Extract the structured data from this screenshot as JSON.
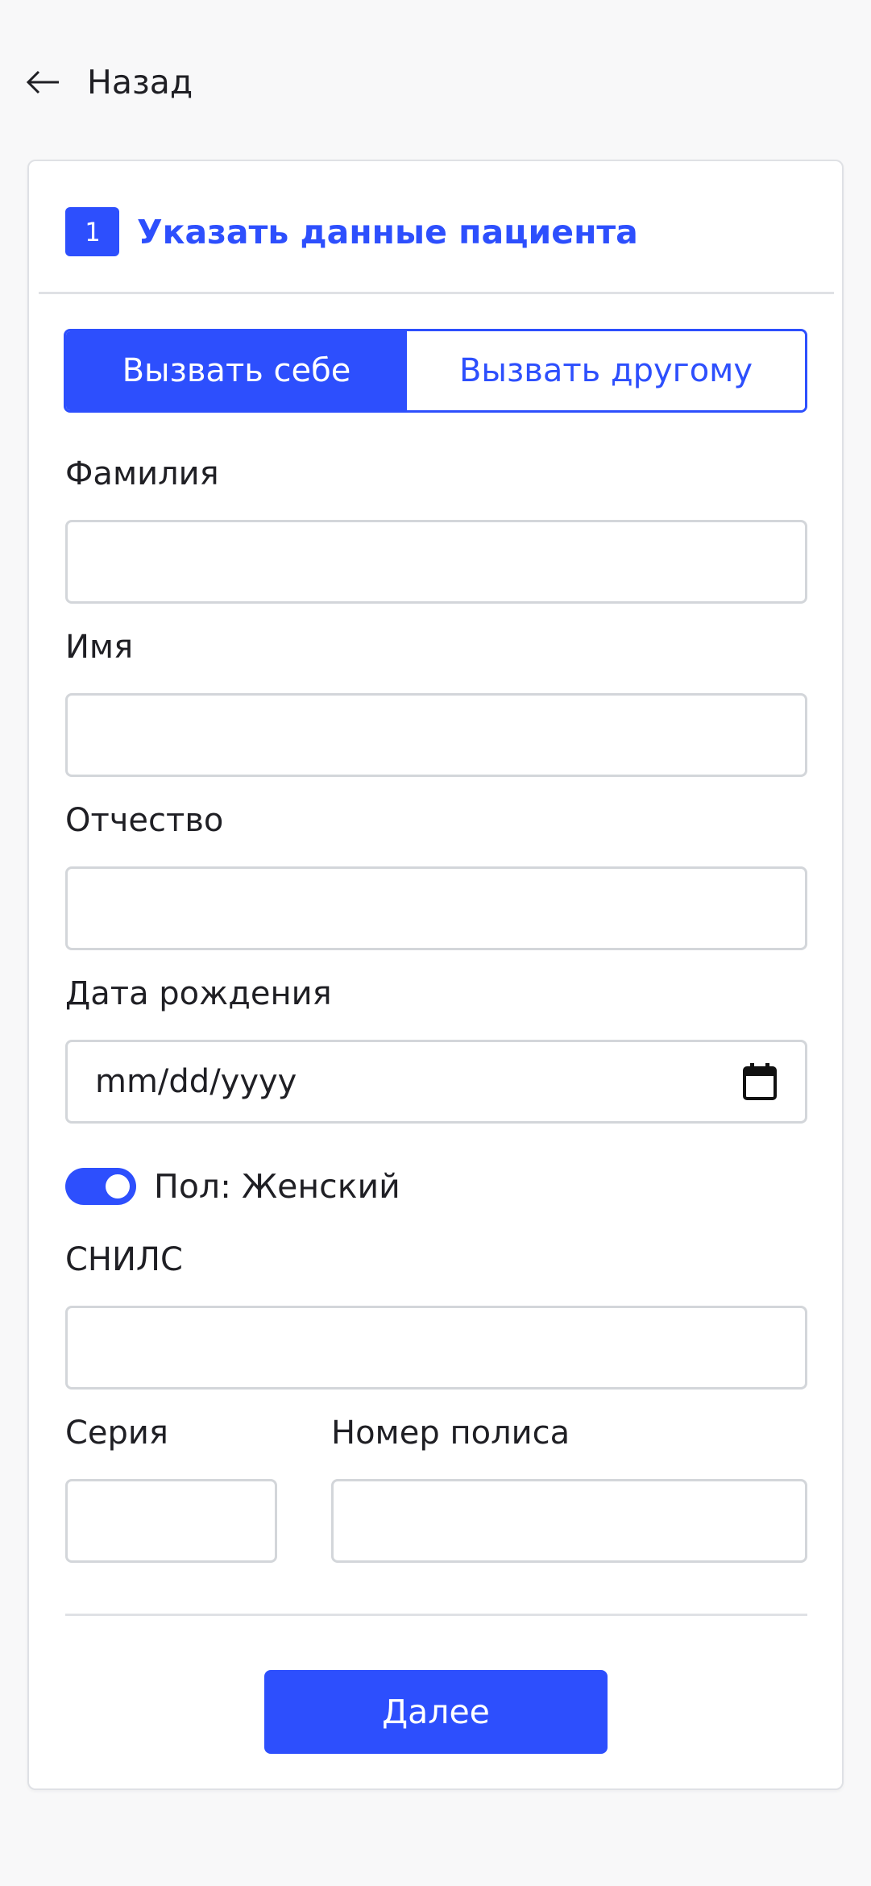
{
  "header": {
    "back_label": "Назад",
    "back_icon": "arrow-left-icon"
  },
  "step": {
    "number": "1",
    "title": "Указать данные пациента"
  },
  "call_mode": {
    "options": [
      "Вызвать себе",
      "Вызвать другому"
    ],
    "selected": "Вызвать себе"
  },
  "fields": {
    "last_name": {
      "label": "Фамилия",
      "value": ""
    },
    "first_name": {
      "label": "Имя",
      "value": ""
    },
    "patronymic": {
      "label": "Отчество",
      "value": ""
    },
    "birth_date": {
      "label": "Дата рождения",
      "placeholder": "mm/dd/yyyy",
      "icon": "calendar-icon"
    },
    "snils": {
      "label": "СНИЛС",
      "value": ""
    },
    "policy_series": {
      "label": "Серия",
      "value": ""
    },
    "policy_number": {
      "label": "Номер полиса",
      "value": ""
    }
  },
  "gender_toggle": {
    "label": "Пол: Женский",
    "on": true
  },
  "actions": {
    "next_label": "Далее"
  },
  "colors": {
    "accent": "#2d4ffd",
    "text": "#1f1f24",
    "border": "#d3d6da",
    "background": "#f8f8f9"
  }
}
